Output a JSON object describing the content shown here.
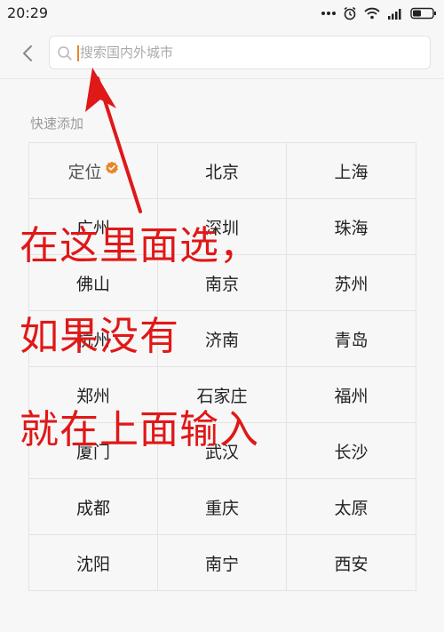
{
  "status_bar": {
    "time": "20:29",
    "icons": [
      "more-dots-icon",
      "alarm-icon",
      "wifi-icon",
      "signal-icon",
      "battery-icon"
    ]
  },
  "header": {
    "back_icon": "chevron-left-icon",
    "search": {
      "placeholder": "搜索国内外城市",
      "value": ""
    }
  },
  "quick_add": {
    "title": "快速添加",
    "cities": [
      [
        "定位",
        "北京",
        "上海"
      ],
      [
        "广州",
        "深圳",
        "珠海"
      ],
      [
        "佛山",
        "南京",
        "苏州"
      ],
      [
        "杭州",
        "济南",
        "青岛"
      ],
      [
        "郑州",
        "石家庄",
        "福州"
      ],
      [
        "厦门",
        "武汉",
        "长沙"
      ],
      [
        "成都",
        "重庆",
        "太原"
      ],
      [
        "沈阳",
        "南宁",
        "西安"
      ]
    ]
  },
  "annotation": {
    "color": "#e01818",
    "lines": [
      "在这里面选，",
      "如果没有",
      "就在上面输入"
    ]
  },
  "colors": {
    "accent": "#e8862a",
    "background": "#f7f7f7"
  }
}
